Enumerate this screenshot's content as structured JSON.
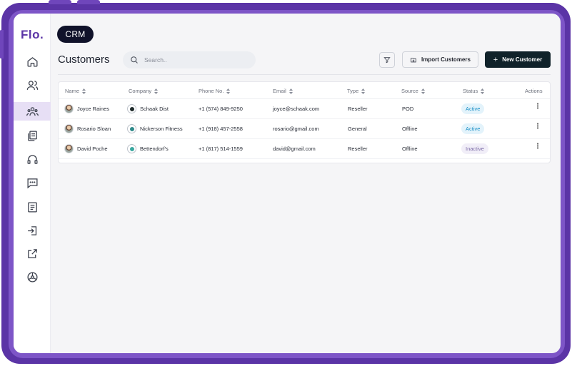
{
  "app": {
    "logo": "Flo.",
    "section_pill": "CRM",
    "page_title": "Customers"
  },
  "search": {
    "placeholder": "Search.."
  },
  "toolbar": {
    "filter_icon": "filter-icon",
    "import_label": "Import Customers",
    "new_label": "New Customer"
  },
  "sidebar": {
    "items": [
      {
        "icon": "home-icon"
      },
      {
        "icon": "users-icon"
      },
      {
        "icon": "customers-icon",
        "active": true
      },
      {
        "icon": "documents-icon"
      },
      {
        "icon": "headset-icon"
      },
      {
        "icon": "chat-icon"
      },
      {
        "icon": "report-icon"
      },
      {
        "icon": "login-icon"
      },
      {
        "icon": "external-link-icon"
      },
      {
        "icon": "settings-wheel-icon"
      }
    ]
  },
  "table": {
    "columns": [
      "Name",
      "Company",
      "Phone No.",
      "Email",
      "Type",
      "Source",
      "Status",
      "Actions"
    ],
    "rows": [
      {
        "name": "Joyce Raines",
        "company": "Schaak Dist",
        "phone": "+1 (574) 849-9250",
        "email": "joyce@schaak.com",
        "type": "Reseller",
        "source": "POD",
        "status": "Active"
      },
      {
        "name": "Rosario Sloan",
        "company": "Nickerson Fitness",
        "phone": "+1 (918) 457-2558",
        "email": "rosario@gmail.com",
        "type": "General",
        "source": "Offline",
        "status": "Active"
      },
      {
        "name": "David Poche",
        "company": "Bettendorf's",
        "phone": "+1 (817) 514-1559",
        "email": "david@gmail.com",
        "type": "Reseller",
        "source": "Offline",
        "status": "Inactive"
      }
    ]
  },
  "colors": {
    "brand_purple": "#5b34a6",
    "active_status": "#1a8fc6",
    "inactive_status": "#7a6aa6",
    "primary_button": "#10222a"
  }
}
